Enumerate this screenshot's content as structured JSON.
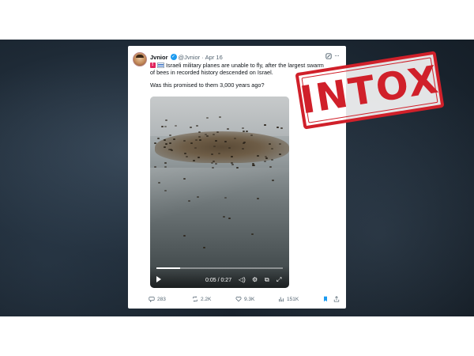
{
  "tweet": {
    "display_name": "Jvnior",
    "handle": "@Jvnior",
    "separator": "·",
    "date": "Apr 16",
    "text": "Israeli military planes are unable to fly, after the largest swarm of bees in recorded history descended on Israel.",
    "question": "Was this promised to them 3,000 years ago?",
    "more_label": "···"
  },
  "video": {
    "time": "0:05 / 0:27",
    "progress": 0.185
  },
  "actions": {
    "replies": "283",
    "reposts": "2.2K",
    "likes": "9.3K",
    "views": "151K"
  },
  "stamp": {
    "text": "INTOX",
    "color": "#d0202a"
  },
  "colors": {
    "verified": "#1d9bf0",
    "bookmark_active": "#1d9bf0"
  },
  "icons": [
    "verified-badge-icon",
    "grok-icon",
    "more-icon",
    "play-icon",
    "volume-icon",
    "settings-icon",
    "pip-icon",
    "fullscreen-icon",
    "reply-icon",
    "repost-icon",
    "like-icon",
    "views-icon",
    "bookmark-icon",
    "share-icon"
  ]
}
